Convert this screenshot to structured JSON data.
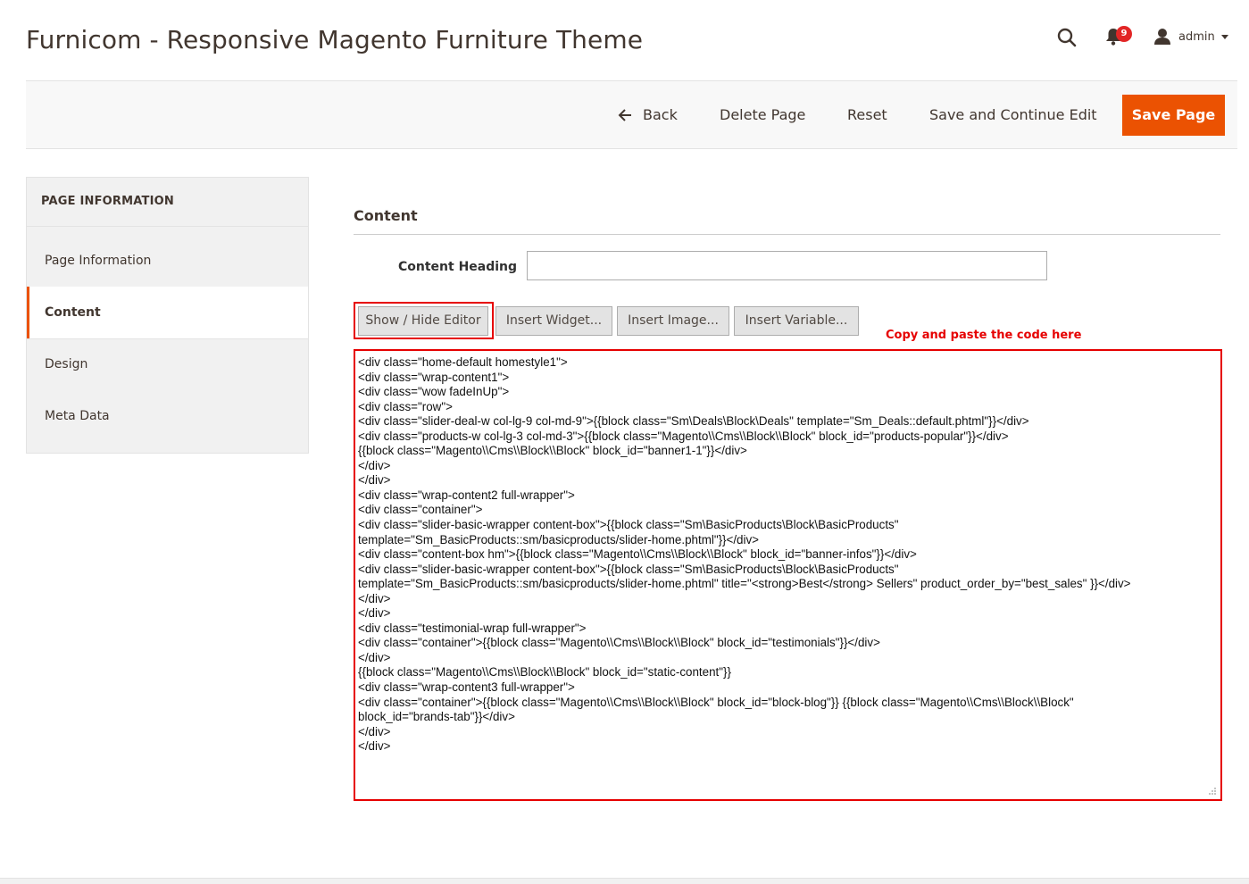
{
  "header": {
    "title": "Furnicom - Responsive Magento Furniture Theme",
    "notification_count": "9",
    "user_name": "admin"
  },
  "actions": {
    "back": "Back",
    "delete": "Delete Page",
    "reset": "Reset",
    "save_continue": "Save and Continue Edit",
    "save": "Save Page"
  },
  "sidebar": {
    "title": "PAGE INFORMATION",
    "items": [
      {
        "label": "Page Information"
      },
      {
        "label": "Content"
      },
      {
        "label": "Design"
      },
      {
        "label": "Meta Data"
      }
    ]
  },
  "content": {
    "section_title": "Content",
    "heading_label": "Content Heading",
    "heading_value": "",
    "buttons": {
      "show_hide": "Show / Hide Editor",
      "insert_widget": "Insert Widget...",
      "insert_image": "Insert Image...",
      "insert_variable": "Insert Variable..."
    },
    "annotation": "Copy and paste the code here",
    "code": "<div class=\"home-default homestyle1\">\n<div class=\"wrap-content1\">\n<div class=\"wow fadeInUp\">\n<div class=\"row\">\n<div class=\"slider-deal-w col-lg-9 col-md-9\">{{block class=\"Sm\\Deals\\Block\\Deals\" template=\"Sm_Deals::default.phtml\"}}</div>\n<div class=\"products-w col-lg-3 col-md-3\">{{block class=\"Magento\\\\Cms\\\\Block\\\\Block\" block_id=\"products-popular\"}}</div>\n{{block class=\"Magento\\\\Cms\\\\Block\\\\Block\" block_id=\"banner1-1\"}}</div>\n</div>\n</div>\n<div class=\"wrap-content2 full-wrapper\">\n<div class=\"container\">\n<div class=\"slider-basic-wrapper content-box\">{{block class=\"Sm\\BasicProducts\\Block\\BasicProducts\"\ntemplate=\"Sm_BasicProducts::sm/basicproducts/slider-home.phtml\"}}</div>\n<div class=\"content-box hm\">{{block class=\"Magento\\\\Cms\\\\Block\\\\Block\" block_id=\"banner-infos\"}}</div>\n<div class=\"slider-basic-wrapper content-box\">{{block class=\"Sm\\BasicProducts\\Block\\BasicProducts\"\ntemplate=\"Sm_BasicProducts::sm/basicproducts/slider-home.phtml\" title=\"<strong>Best</strong> Sellers\" product_order_by=\"best_sales\" }}</div>\n</div>\n</div>\n<div class=\"testimonial-wrap full-wrapper\">\n<div class=\"container\">{{block class=\"Magento\\\\Cms\\\\Block\\\\Block\" block_id=\"testimonials\"}}</div>\n</div>\n{{block class=\"Magento\\\\Cms\\\\Block\\\\Block\" block_id=\"static-content\"}}\n<div class=\"wrap-content3 full-wrapper\">\n<div class=\"container\">{{block class=\"Magento\\\\Cms\\\\Block\\\\Block\" block_id=\"block-blog\"}} {{block class=\"Magento\\\\Cms\\\\Block\\\\Block\"\nblock_id=\"brands-tab\"}}</div>\n</div>\n</div>"
  },
  "colors": {
    "accent": "#eb5202",
    "annotation": "#e60000",
    "badge": "#e22626"
  }
}
